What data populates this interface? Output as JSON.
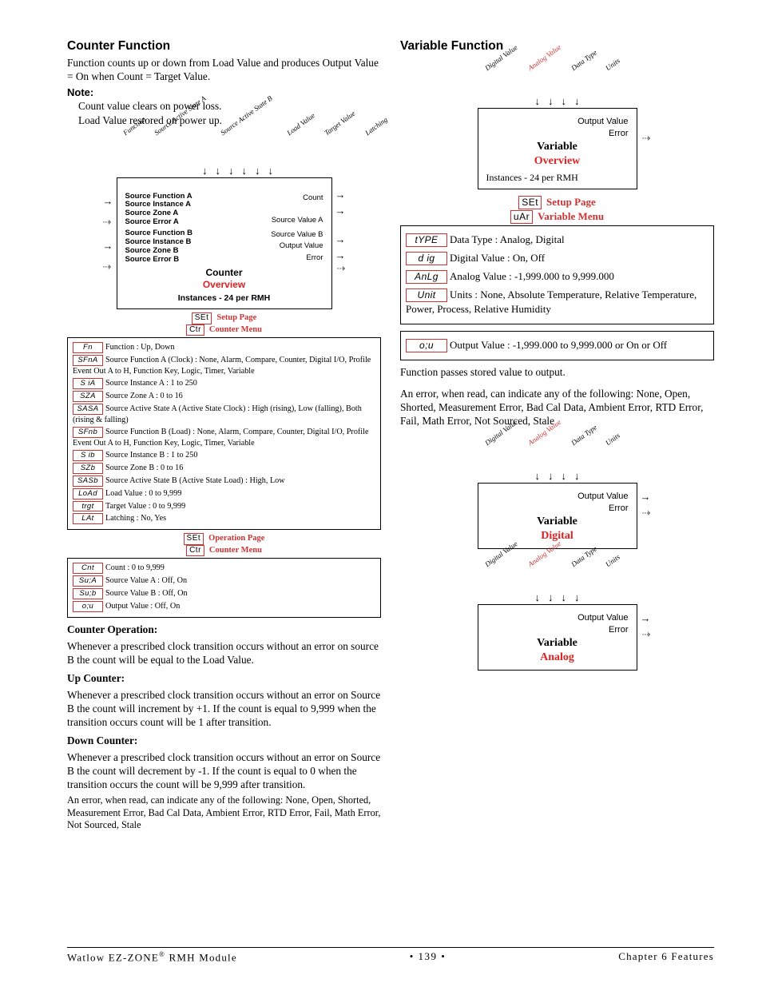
{
  "left": {
    "title": "Counter Function",
    "desc": "Function counts up or down from Load Value and produces Output Value = On when Count = Target Value.",
    "note_label": "Note:",
    "note_line1": "Count value clears on power loss.",
    "note_line2": "Load Value restored on power up.",
    "diagram": {
      "top_inputs": [
        "Source Active State A",
        "Source Active State B",
        "Load Value",
        "Target Value",
        "Latching",
        "Function"
      ],
      "left_block1": "Source Function A\nSource Instance A\nSource Zone A\nSource Error A",
      "left_block2": "Source Function B\nSource Instance B\nSource Zone B\nSource Error B",
      "right_outputs": [
        "Count",
        "Source Value A",
        "Source Value B",
        "Output Value",
        "Error"
      ],
      "name": "Counter",
      "subtitle": "Overview",
      "instances": "Instances - 24 per RMH"
    },
    "setup_menu": {
      "tag1": "SEt",
      "lbl1": "Setup Page",
      "tag2": "Ctr",
      "lbl2": "Counter Menu"
    },
    "setup_params": [
      {
        "tag": "Fn",
        "text": "Function : Up, Down"
      },
      {
        "tag": "SFnA",
        "text": "Source Function A (Clock) : None, Alarm, Compare, Counter, Digital I/O, Profile Event Out A to H, Function Key, Logic, Timer, Variable"
      },
      {
        "tag": "S iA",
        "text": "Source Instance A : 1 to 250"
      },
      {
        "tag": "SZA",
        "text": "Source Zone A : 0 to 16"
      },
      {
        "tag": "SASA",
        "text": "Source Active State A (Active State Clock) : High (rising), Low (falling), Both (rising & falling)"
      },
      {
        "tag": "SFnb",
        "text": "Source Function B (Load) : None, Alarm, Compare, Counter, Digital I/O, Profile Event Out A to H, Function Key, Logic, Timer, Variable"
      },
      {
        "tag": "S ib",
        "text": "Source Instance B : 1 to 250"
      },
      {
        "tag": "SZb",
        "text": "Source Zone B : 0 to 16"
      },
      {
        "tag": "SASb",
        "text": "Source Active State B (Active State Load) : High, Low"
      },
      {
        "tag": "LoAd",
        "text": "Load Value : 0 to 9,999"
      },
      {
        "tag": "trgt",
        "text": "Target Value : 0 to 9,999"
      },
      {
        "tag": "LAt",
        "text": "Latching : No, Yes"
      }
    ],
    "oper_menu": {
      "tag1": "SEt",
      "lbl1": "Operation Page",
      "tag2": "Ctr",
      "lbl2": "Counter Menu"
    },
    "oper_params": [
      {
        "tag": "Cnt",
        "text": "Count : 0 to 9,999"
      },
      {
        "tag": "Su;A",
        "text": "Source Value A : Off, On"
      },
      {
        "tag": "Su;b",
        "text": "Source Value B : Off, On"
      },
      {
        "tag": "o;u",
        "text": "Output Value : Off, On"
      }
    ],
    "op_title": "Counter Operation:",
    "op_text": "Whenever a prescribed clock transition occurs without an error on source B the count will be equal to the Load Value.",
    "up_title": "Up Counter:",
    "up_text": "Whenever a prescribed clock transition occurs without an error on Source B the count will increment by +1. If the count is equal to 9,999 when the transition occurs count will be 1 after transition.",
    "down_title": "Down Counter:",
    "down_text": "Whenever a prescribed clock transition occurs without an error on Source B the count will decrement by -1. If the count is equal to 0 when the transition occurs the count will be 9,999 after transition.",
    "err_text": "An error, when read, can indicate any of the following: None, Open, Shorted, Measurement Error, Bad Cal Data, Ambient Error, RTD Error, Fail, Math Error, Not Sourced, Stale"
  },
  "right": {
    "title": "Variable Function",
    "diagram_overview": {
      "top_inputs": [
        "Digital Value",
        "Analog Value",
        "Data Type",
        "Units"
      ],
      "out1": "Output Value",
      "out2": "Error",
      "name": "Variable",
      "subtitle": "Overview",
      "instances": "Instances - 24 per RMH"
    },
    "setup_menu": {
      "tag1": "SEt",
      "lbl1": "Setup Page",
      "tag2": "uAr",
      "lbl2": "Variable Menu"
    },
    "setup_params": [
      {
        "tag": "tYPE",
        "text": "Data Type : Analog, Digital"
      },
      {
        "tag": "d ig",
        "text": "Digital Value : On, Off"
      },
      {
        "tag": "AnLg",
        "text": "Analog Value : -1,999.000 to 9,999.000"
      },
      {
        "tag": "Unit",
        "text": "Units : None, Absolute Temperature, Relative Temperature, Power, Process, Relative Humidity"
      }
    ],
    "oper_params": [
      {
        "tag": "o;u",
        "text": "Output Value : -1,999.000 to 9,999.000 or On or Off"
      }
    ],
    "func_text": "Function passes stored value to output.",
    "err_text": "An error, when read, can indicate any of the following: None, Open, Shorted, Measurement Error, Bad Cal Data, Ambient Error, RTD Error, Fail, Math Error, Not Sourced, Stale",
    "diagram_digital": {
      "top_inputs": [
        "Digital Value",
        "Analog Value",
        "Data Type",
        "Units"
      ],
      "out1": "Output Value",
      "out2": "Error",
      "name": "Variable",
      "subtitle": "Digital"
    },
    "diagram_analog": {
      "top_inputs": [
        "Digital Value",
        "Analog Value",
        "Data Type",
        "Units"
      ],
      "out1": "Output Value",
      "out2": "Error",
      "name": "Variable",
      "subtitle": "Analog"
    }
  },
  "footer": {
    "left_a": "Watlow EZ-ZONE",
    "left_b": " RMH Module",
    "page": "• 139 •",
    "right": "Chapter 6 Features"
  }
}
